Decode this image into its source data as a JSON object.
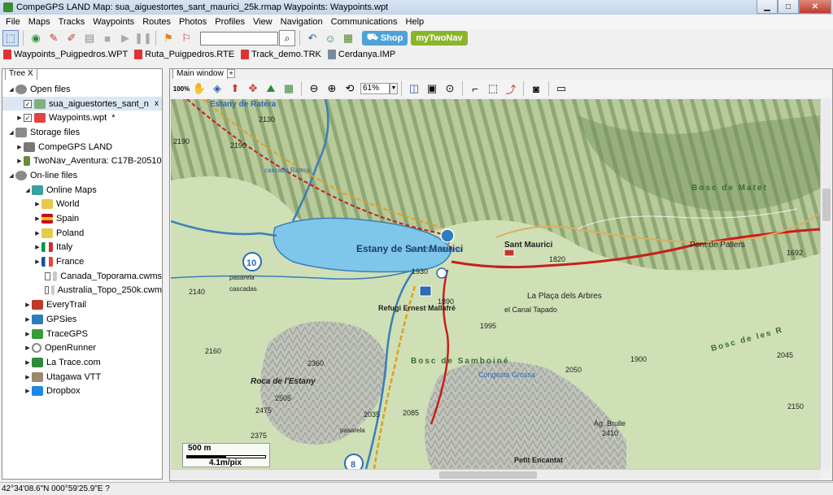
{
  "window": {
    "title": "CompeGPS LAND Map: sua_aiguestortes_sant_maurici_25k.rmap Waypoints: Waypoints.wpt"
  },
  "menu": [
    "File",
    "Maps",
    "Tracks",
    "Waypoints",
    "Routes",
    "Photos",
    "Profiles",
    "View",
    "Navigation",
    "Communications",
    "Help"
  ],
  "toolbar": {
    "shop_label": "Shop",
    "mytwonav_label": "myTwoNav",
    "search_value": ""
  },
  "open_files_bar": [
    "Waypoints_Puigpedros.WPT",
    "Ruta_Puigpedros.RTE",
    "Track_demo.TRK",
    "Cerdanya.IMP"
  ],
  "tree_panel": {
    "tab_label": "Tree",
    "tab_close": "X",
    "items": [
      {
        "label": "Open files"
      },
      {
        "label": "sua_aiguestortes_sant_n",
        "close": "x"
      },
      {
        "label": "Waypoints.wpt",
        "mark": "*"
      },
      {
        "label": "Storage files"
      },
      {
        "label": "CompeGPS LAND"
      },
      {
        "label": "TwoNav_Aventura: C17B-20510"
      },
      {
        "label": "On-line files"
      },
      {
        "label": "Online Maps"
      },
      {
        "label": "World"
      },
      {
        "label": "Spain"
      },
      {
        "label": "Poland"
      },
      {
        "label": "Italy"
      },
      {
        "label": "France"
      },
      {
        "label": "Canada_Toporama.cwms"
      },
      {
        "label": "Australia_Topo_250k.cwm"
      },
      {
        "label": "EveryTrail"
      },
      {
        "label": "GPSies"
      },
      {
        "label": "TraceGPS"
      },
      {
        "label": "OpenRunner"
      },
      {
        "label": "La Trace.com"
      },
      {
        "label": "Utagawa VTT"
      },
      {
        "label": "Dropbox"
      }
    ]
  },
  "map_window": {
    "tab_label": "Main window",
    "add_tab": "+",
    "zoom_value": "61%",
    "zoom_100_label": "100%",
    "scale_distance": "500 m",
    "scale_resolution": "4.1m/pix"
  },
  "map_labels": {
    "lake": "Estany de Sant Maurici",
    "estany_ratera": "Estany de Ratera",
    "cascada_ratera": "cascada\nRatera",
    "font": "Font\nSant Maurici",
    "sant_maurici": "Sant Maurici",
    "pont_pallers": "Pont de Pallers",
    "placa_arbres": "La Plaça dels Arbres",
    "canal": "el Canal Tapado",
    "refugi": "Refugi\nErnest Mallafré",
    "roca": "Roca de l'Estany",
    "bosc_samboine": "Bosc de Samboiné",
    "bosc_les": "Bosc de les R",
    "bosc_matet": "Bosc de Matet",
    "congesta": "Congesta\nGrossa",
    "brulle": "Ag. Brulle",
    "petit_encantat": "Petit Encantat",
    "pasarela1": "pasarela",
    "cascadas": "cascadas",
    "pasarela2": "pasarela",
    "route_10": "10",
    "route_8": "8",
    "elevations": [
      "2130",
      "2190",
      "2190",
      "2140",
      "1930",
      "1890",
      "1995",
      "1820",
      "1900",
      "2045",
      "2050",
      "1692",
      "2160",
      "2360",
      "2505",
      "2475",
      "2375",
      "2035",
      "2085",
      "2150",
      "2410"
    ]
  },
  "status": {
    "coordinates": "42°34'08.6\"N 000°59'25.9\"E ?"
  }
}
